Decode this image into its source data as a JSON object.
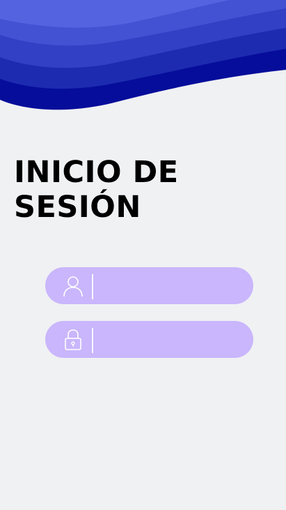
{
  "title": {
    "line1": "INICIO DE",
    "line2": "SESIÓN"
  },
  "username_field": {
    "value": "",
    "placeholder": "",
    "icon": "user-icon"
  },
  "password_field": {
    "value": "",
    "placeholder": "",
    "icon": "lock-icon"
  },
  "colors": {
    "background": "#f0f1f3",
    "wave_light": "#5463e0",
    "wave_dark": "#050d9a",
    "field_fill": "#c9b6fc",
    "icon_stroke": "#ffffff"
  }
}
